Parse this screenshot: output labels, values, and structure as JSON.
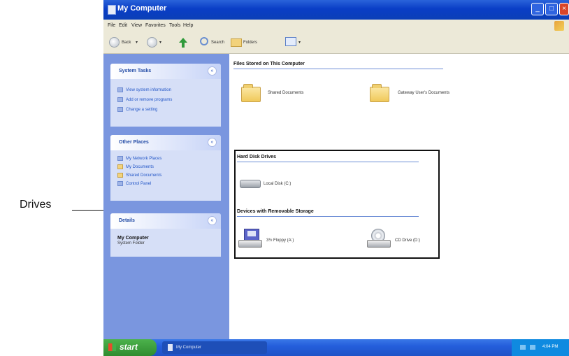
{
  "callout": {
    "label": "Drives"
  },
  "window": {
    "title": "My Computer",
    "menu": [
      "File",
      "Edit",
      "View",
      "Favorites",
      "Tools",
      "Help"
    ],
    "toolbar": {
      "back": "Back",
      "search": "Search",
      "folders": "Folders"
    }
  },
  "taskpane": {
    "system_tasks": {
      "title": "System Tasks",
      "items": [
        "View system information",
        "Add or remove programs",
        "Change a setting"
      ]
    },
    "other_places": {
      "title": "Other Places",
      "items": [
        "My Network Places",
        "My Documents",
        "Shared Documents",
        "Control Panel"
      ]
    },
    "details": {
      "title": "Details",
      "name": "My Computer",
      "subtitle": "System Folder"
    }
  },
  "content": {
    "files_section": {
      "title": "Files Stored on This Computer",
      "items": [
        "Shared Documents",
        "Gateway User's Documents"
      ]
    },
    "hard_disks": {
      "title": "Hard Disk Drives",
      "items": [
        "Local Disk (C:)"
      ]
    },
    "removable": {
      "title": "Devices with Removable Storage",
      "items": [
        "3½ Floppy (A:)",
        "CD Drive (D:)"
      ]
    }
  },
  "taskbar": {
    "start": "start",
    "task": "My Computer",
    "clock": "4:04 PM"
  },
  "colors": {
    "titlebar": "#0a3ec6",
    "taskpane": "#7a96df",
    "taskbar": "#245edb",
    "start": "#3fa33f"
  }
}
